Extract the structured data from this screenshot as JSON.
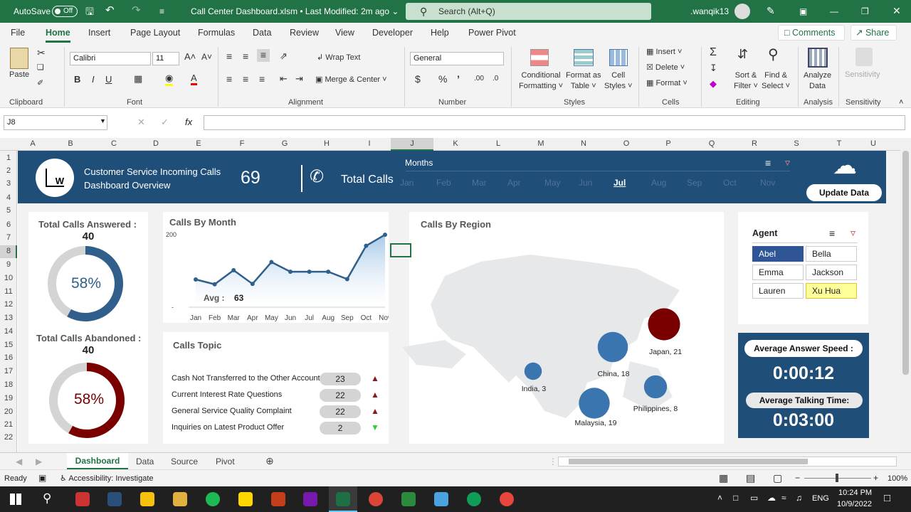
{
  "titlebar": {
    "autosave": "AutoSave",
    "toggle": "Off",
    "file_title": "Call Center Dashboard.xlsm • Last Modified: 2m ago ⌄",
    "search": "Search (Alt+Q)",
    "user": ".wanqik13"
  },
  "menu": [
    "File",
    "Home",
    "Insert",
    "Page Layout",
    "Formulas",
    "Data",
    "Review",
    "View",
    "Developer",
    "Help",
    "Power Pivot"
  ],
  "menu_right": {
    "comments": "Comments",
    "share": "Share"
  },
  "ribbon": {
    "paste": "Paste",
    "font_name": "Calibri",
    "font_size": "11",
    "wrap": "Wrap Text",
    "merge": "Merge & Center",
    "number_format": "General",
    "cond": [
      "Conditional",
      "Formatting ˅"
    ],
    "fmt_table": [
      "Format as",
      "Table ˅"
    ],
    "cell_styles": [
      "Cell",
      "Styles ˅"
    ],
    "insert": "Insert",
    "delete": "Delete",
    "format": "Format",
    "sort": [
      "Sort &",
      "Filter ˅"
    ],
    "find": [
      "Find &",
      "Select ˅"
    ],
    "analyze": [
      "Analyze",
      "Data"
    ],
    "sensitivity": "Sensitivity",
    "groups": [
      "Clipboard",
      "Font",
      "Alignment",
      "Number",
      "Styles",
      "Cells",
      "Editing",
      "Analysis",
      "Sensitivity"
    ]
  },
  "formula": {
    "namebox": "J8",
    "fx": "fx"
  },
  "columns": [
    "A",
    "B",
    "C",
    "D",
    "E",
    "F",
    "G",
    "H",
    "I",
    "J",
    "K",
    "L",
    "M",
    "N",
    "O",
    "P",
    "Q",
    "R",
    "S",
    "T",
    "U"
  ],
  "rows": [
    "1",
    "2",
    "3",
    "4",
    "5",
    "6",
    "7",
    "8",
    "9",
    "10",
    "11",
    "12",
    "13",
    "14",
    "15",
    "16",
    "17",
    "18",
    "19",
    "20",
    "21",
    "22"
  ],
  "banner": {
    "line1": "Customer Service Incoming Calls",
    "line2": "Dashboard Overview",
    "count": "69",
    "total_calls": "Total Calls",
    "months_label": "Months",
    "months": [
      "Jan",
      "Feb",
      "Mar",
      "Apr",
      "May",
      "Jun",
      "Jul",
      "Aug",
      "Sep",
      "Oct",
      "Nov"
    ],
    "selected_month": "Jul",
    "update": "Update Data",
    "logo_letter": "W"
  },
  "answered": {
    "title": "Total Calls Answered :",
    "value": "40",
    "pct": "58%",
    "fraction": 0.58
  },
  "abandoned": {
    "title": "Total Calls Abandoned :",
    "value": "40",
    "pct": "58%",
    "fraction": 0.58
  },
  "calls_by_month": {
    "title": "Calls By Month",
    "avg_label": "Avg :",
    "avg_value": "63"
  },
  "chart_data": {
    "type": "area",
    "title": "Calls By Month",
    "x": [
      "Jan",
      "Feb",
      "Mar",
      "Apr",
      "May",
      "Jun",
      "Jul",
      "Aug",
      "Sep",
      "Oct",
      "Nov"
    ],
    "values": [
      75,
      62,
      100,
      63,
      122,
      96,
      96,
      96,
      76,
      166,
      196
    ],
    "ylim": [
      0,
      200
    ],
    "ytick_top": "200",
    "ytick_bottom": "-"
  },
  "topics": {
    "title": "Calls Topic",
    "items": [
      {
        "label": "Cash Not Transferred to the Other Account",
        "value": "23",
        "trend": "▲",
        "color": "#8b1a1a"
      },
      {
        "label": "Current Interest Rate Questions",
        "value": "22",
        "trend": "▲",
        "color": "#8b1a1a"
      },
      {
        "label": "General Service Quality Complaint",
        "value": "22",
        "trend": "▲",
        "color": "#8b1a1a"
      },
      {
        "label": "Inquiries on Latest Product Offer",
        "value": "2",
        "trend": "▼",
        "color": "#2ecc40"
      }
    ]
  },
  "region": {
    "title": "Calls By Region",
    "bubbles": [
      {
        "label": "Japan,  21",
        "value": 21,
        "color": "#7a0000"
      },
      {
        "label": "China,  18",
        "value": 18,
        "color": "#3a75b0"
      },
      {
        "label": "India,  3",
        "value": 3,
        "color": "#3a75b0"
      },
      {
        "label": "Philippines,  8",
        "value": 8,
        "color": "#3a75b0"
      },
      {
        "label": "Malaysia,  19",
        "value": 19,
        "color": "#3a75b0"
      }
    ]
  },
  "agents": {
    "title": "Agent",
    "names": [
      "Abel",
      "Bella",
      "Emma",
      "Jackson",
      "Lauren",
      "Xu Hua"
    ],
    "selected": "Abel",
    "hovered": "Xu Hua"
  },
  "speed": {
    "answer_label": "Average Answer Speed :",
    "answer_value": "0:00:12",
    "talk_label": "Average Talking Time:",
    "talk_value": "0:03:00"
  },
  "tabs": [
    "Dashboard",
    "Data",
    "Source",
    "Pivot"
  ],
  "status": {
    "ready": "Ready",
    "accessibility": "Accessibility: Investigate",
    "zoom": "100%"
  },
  "taskbar": {
    "time": "10:24 PM",
    "date": "10/9/2022",
    "lang": "ENG"
  }
}
